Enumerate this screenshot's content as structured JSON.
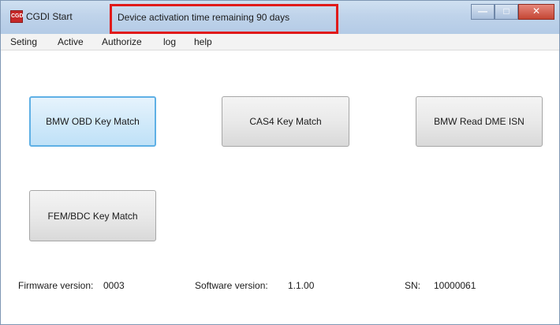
{
  "window": {
    "title": "CGDI Start",
    "icon_text": "CGD",
    "activation_notice": "Device activation time remaining 90 days"
  },
  "window_controls": {
    "minimize": "minimize-icon",
    "maximize": "maximize-icon",
    "close": "close-icon"
  },
  "menu": {
    "items": [
      "Seting",
      "Active",
      "Authorize",
      "log",
      "help"
    ]
  },
  "buttons": {
    "bmw_obd_key_match": "BMW OBD Key Match",
    "cas4_key_match": "CAS4 Key Match",
    "bmw_read_dme_isn": "BMW Read DME ISN",
    "fem_bdc_key_match": "FEM/BDC Key Match"
  },
  "status": {
    "firmware_label": "Firmware version:",
    "firmware_value": "0003",
    "software_label": "Software version:",
    "software_value": "1.1.00",
    "sn_label": "SN:",
    "sn_value": "10000061"
  },
  "colors": {
    "highlight_border": "#e01a1a",
    "focused_button_border": "#5fb0e5",
    "titlebar": "#bfd3ea"
  }
}
